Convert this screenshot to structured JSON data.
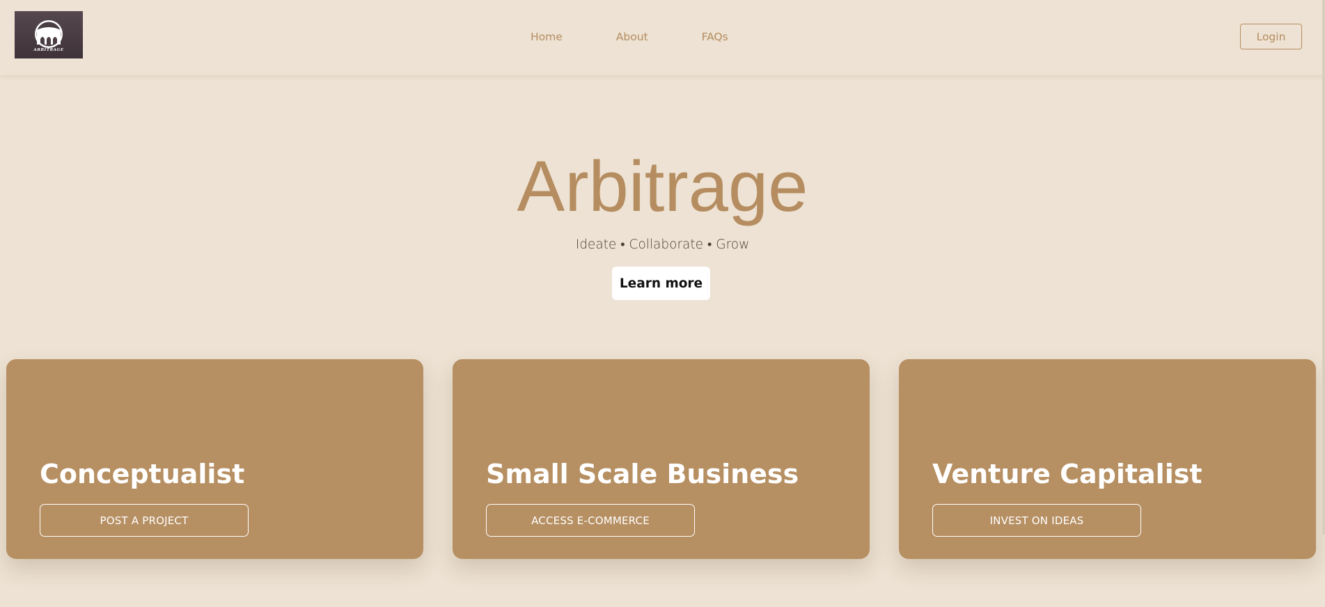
{
  "header": {
    "logo_text": "ARBITRAGE",
    "nav": [
      {
        "label": "Home"
      },
      {
        "label": "About"
      },
      {
        "label": "FAQs"
      }
    ],
    "login_label": "Login"
  },
  "hero": {
    "title": "Arbitrage",
    "tagline": "Ideate • Collaborate • Grow",
    "cta_label": "Learn more"
  },
  "cards": [
    {
      "title": "Conceptualist",
      "button_label": "POST A PROJECT"
    },
    {
      "title": "Small Scale Business",
      "button_label": "ACCESS E-COMMERCE"
    },
    {
      "title": "Venture Capitalist",
      "button_label": "INVEST ON IDEAS"
    }
  ],
  "colors": {
    "background": "#ede2d3",
    "accent": "#b58d60",
    "card": "#b68f62",
    "logo_bg": "#4a3d43"
  }
}
